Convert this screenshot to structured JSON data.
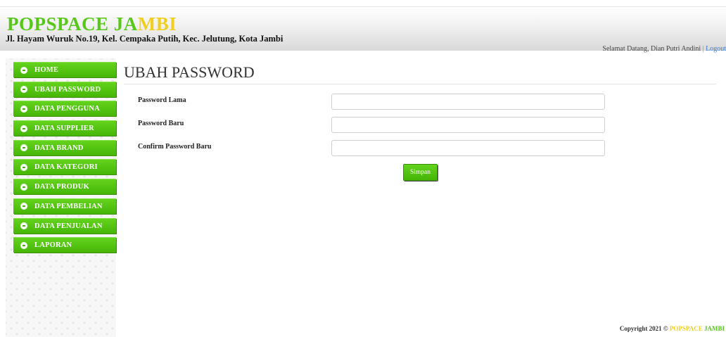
{
  "header": {
    "brand_part1": "POPSPACE JA",
    "brand_part2": "MBI",
    "address": "Jl. Hayam Wuruk No.19, Kel. Cempaka Putih, Kec. Jelutung, Kota Jambi",
    "welcome_text": "Selamat Datang, Dian Putri Andini",
    "separator": " | ",
    "logout_label": "Logout"
  },
  "sidebar": {
    "items": [
      {
        "label": "HOME"
      },
      {
        "label": "UBAH PASSWORD"
      },
      {
        "label": "DATA PENGGUNA"
      },
      {
        "label": "DATA SUPPLIER"
      },
      {
        "label": "DATA BRAND"
      },
      {
        "label": "DATA KATEGORI"
      },
      {
        "label": "DATA PRODUK"
      },
      {
        "label": "DATA PEMBELIAN"
      },
      {
        "label": "DATA PENJUALAN"
      },
      {
        "label": "LAPORAN"
      }
    ]
  },
  "main": {
    "title": "UBAH PASSWORD",
    "fields": [
      {
        "label": "Password Lama",
        "value": "",
        "placeholder": ""
      },
      {
        "label": "Password Baru",
        "value": "",
        "placeholder": ""
      },
      {
        "label": "Confirm Password Baru",
        "value": "",
        "placeholder": ""
      }
    ],
    "submit_label": "Simpan"
  },
  "footer": {
    "copyright_prefix": "Copyright 2021 © ",
    "brand_part1": "POPSPACE ",
    "brand_part2": "JAMBI"
  },
  "colors": {
    "accent_green": "#57c81b",
    "accent_yellow": "#f1cf21",
    "menu_green": "#46b507",
    "link_blue": "#3b78c4"
  }
}
